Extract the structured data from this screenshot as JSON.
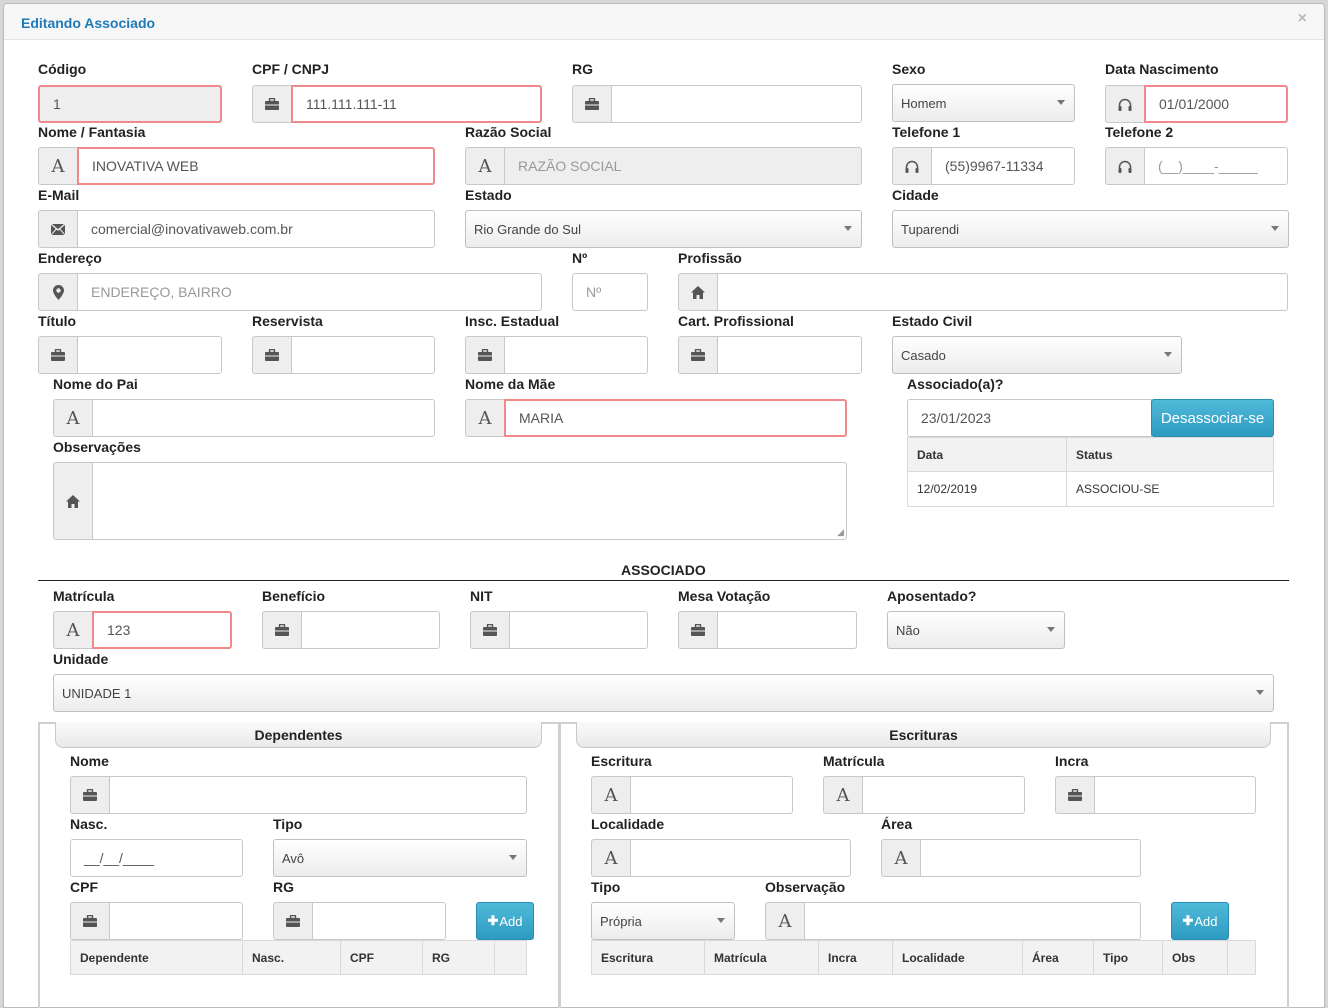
{
  "modal": {
    "title": "Editando Associado",
    "close": "×"
  },
  "form": {
    "codigo": {
      "label": "Código",
      "value": "1"
    },
    "cpf": {
      "label": "CPF / CNPJ",
      "value": "111.111.111-11"
    },
    "rg": {
      "label": "RG",
      "value": ""
    },
    "sexo": {
      "label": "Sexo",
      "value": "Homem"
    },
    "nascimento": {
      "label": "Data Nascimento",
      "value": "01/01/2000"
    },
    "nome": {
      "label": "Nome / Fantasia",
      "value": "INOVATIVA WEB"
    },
    "razao": {
      "label": "Razão Social",
      "placeholder": "RAZÃO SOCIAL"
    },
    "telefone1": {
      "label": "Telefone 1",
      "value": "(55)9967-11334"
    },
    "telefone2": {
      "label": "Telefone 2",
      "value": "(__)____-_____"
    },
    "email": {
      "label": "E-Mail",
      "value": "comercial@inovativaweb.com.br"
    },
    "estado": {
      "label": "Estado",
      "value": "Rio Grande do Sul"
    },
    "cidade": {
      "label": "Cidade",
      "value": "Tuparendi"
    },
    "endereco": {
      "label": "Endereço",
      "placeholder": "ENDEREÇO, BAIRRO"
    },
    "numero": {
      "label": "Nº",
      "placeholder": "Nº"
    },
    "profissao": {
      "label": "Profissão",
      "value": ""
    },
    "titulo": {
      "label": "Título",
      "value": ""
    },
    "reservista": {
      "label": "Reservista",
      "value": ""
    },
    "insc_estadual": {
      "label": "Insc. Estadual",
      "value": ""
    },
    "cart_profissional": {
      "label": "Cart. Profissional",
      "value": ""
    },
    "estado_civil": {
      "label": "Estado Civil",
      "value": "Casado"
    },
    "nome_pai": {
      "label": "Nome do Pai",
      "value": ""
    },
    "nome_mae": {
      "label": "Nome da Mãe",
      "value": "MARIA"
    },
    "observacoes": {
      "label": "Observações",
      "value": ""
    },
    "associado": {
      "label": "Associado(a)?",
      "date": "23/01/2023",
      "button": "Desassociar-se",
      "table": {
        "headers": [
          "Data",
          "Status"
        ],
        "rows": [
          [
            "12/02/2019",
            "ASSOCIOU-SE"
          ]
        ]
      }
    }
  },
  "associado_section": {
    "title": "ASSOCIADO",
    "matricula": {
      "label": "Matrícula",
      "value": "123"
    },
    "beneficio": {
      "label": "Benefício",
      "value": ""
    },
    "nit": {
      "label": "NIT",
      "value": ""
    },
    "mesa": {
      "label": "Mesa Votação",
      "value": ""
    },
    "aposentado": {
      "label": "Aposentado?",
      "value": "Não"
    },
    "unidade": {
      "label": "Unidade",
      "value": "UNIDADE 1"
    }
  },
  "dependentes": {
    "title": "Dependentes",
    "nome": {
      "label": "Nome",
      "value": ""
    },
    "nasc": {
      "label": "Nasc.",
      "value": "__/__/____"
    },
    "tipo": {
      "label": "Tipo",
      "value": "Avô"
    },
    "cpf": {
      "label": "CPF",
      "value": ""
    },
    "rg": {
      "label": "RG",
      "value": ""
    },
    "add_button": "Add",
    "table_headers": [
      "Dependente",
      "Nasc.",
      "CPF",
      "RG",
      ""
    ]
  },
  "escrituras": {
    "title": "Escrituras",
    "escritura": {
      "label": "Escritura",
      "value": ""
    },
    "matricula": {
      "label": "Matrícula",
      "value": ""
    },
    "incra": {
      "label": "Incra",
      "value": ""
    },
    "localidade": {
      "label": "Localidade",
      "value": ""
    },
    "area": {
      "label": "Área",
      "value": ""
    },
    "tipo": {
      "label": "Tipo",
      "value": "Própria"
    },
    "observacao": {
      "label": "Observação",
      "value": ""
    },
    "add_button": "Add",
    "table_headers": [
      "Escritura",
      "Matrícula",
      "Incra",
      "Localidade",
      "Área",
      "Tipo",
      "Obs",
      ""
    ]
  },
  "colors": {
    "title": "#1f7ab8",
    "error_border": "#ef8a8a",
    "button": "#3aa8cd"
  }
}
